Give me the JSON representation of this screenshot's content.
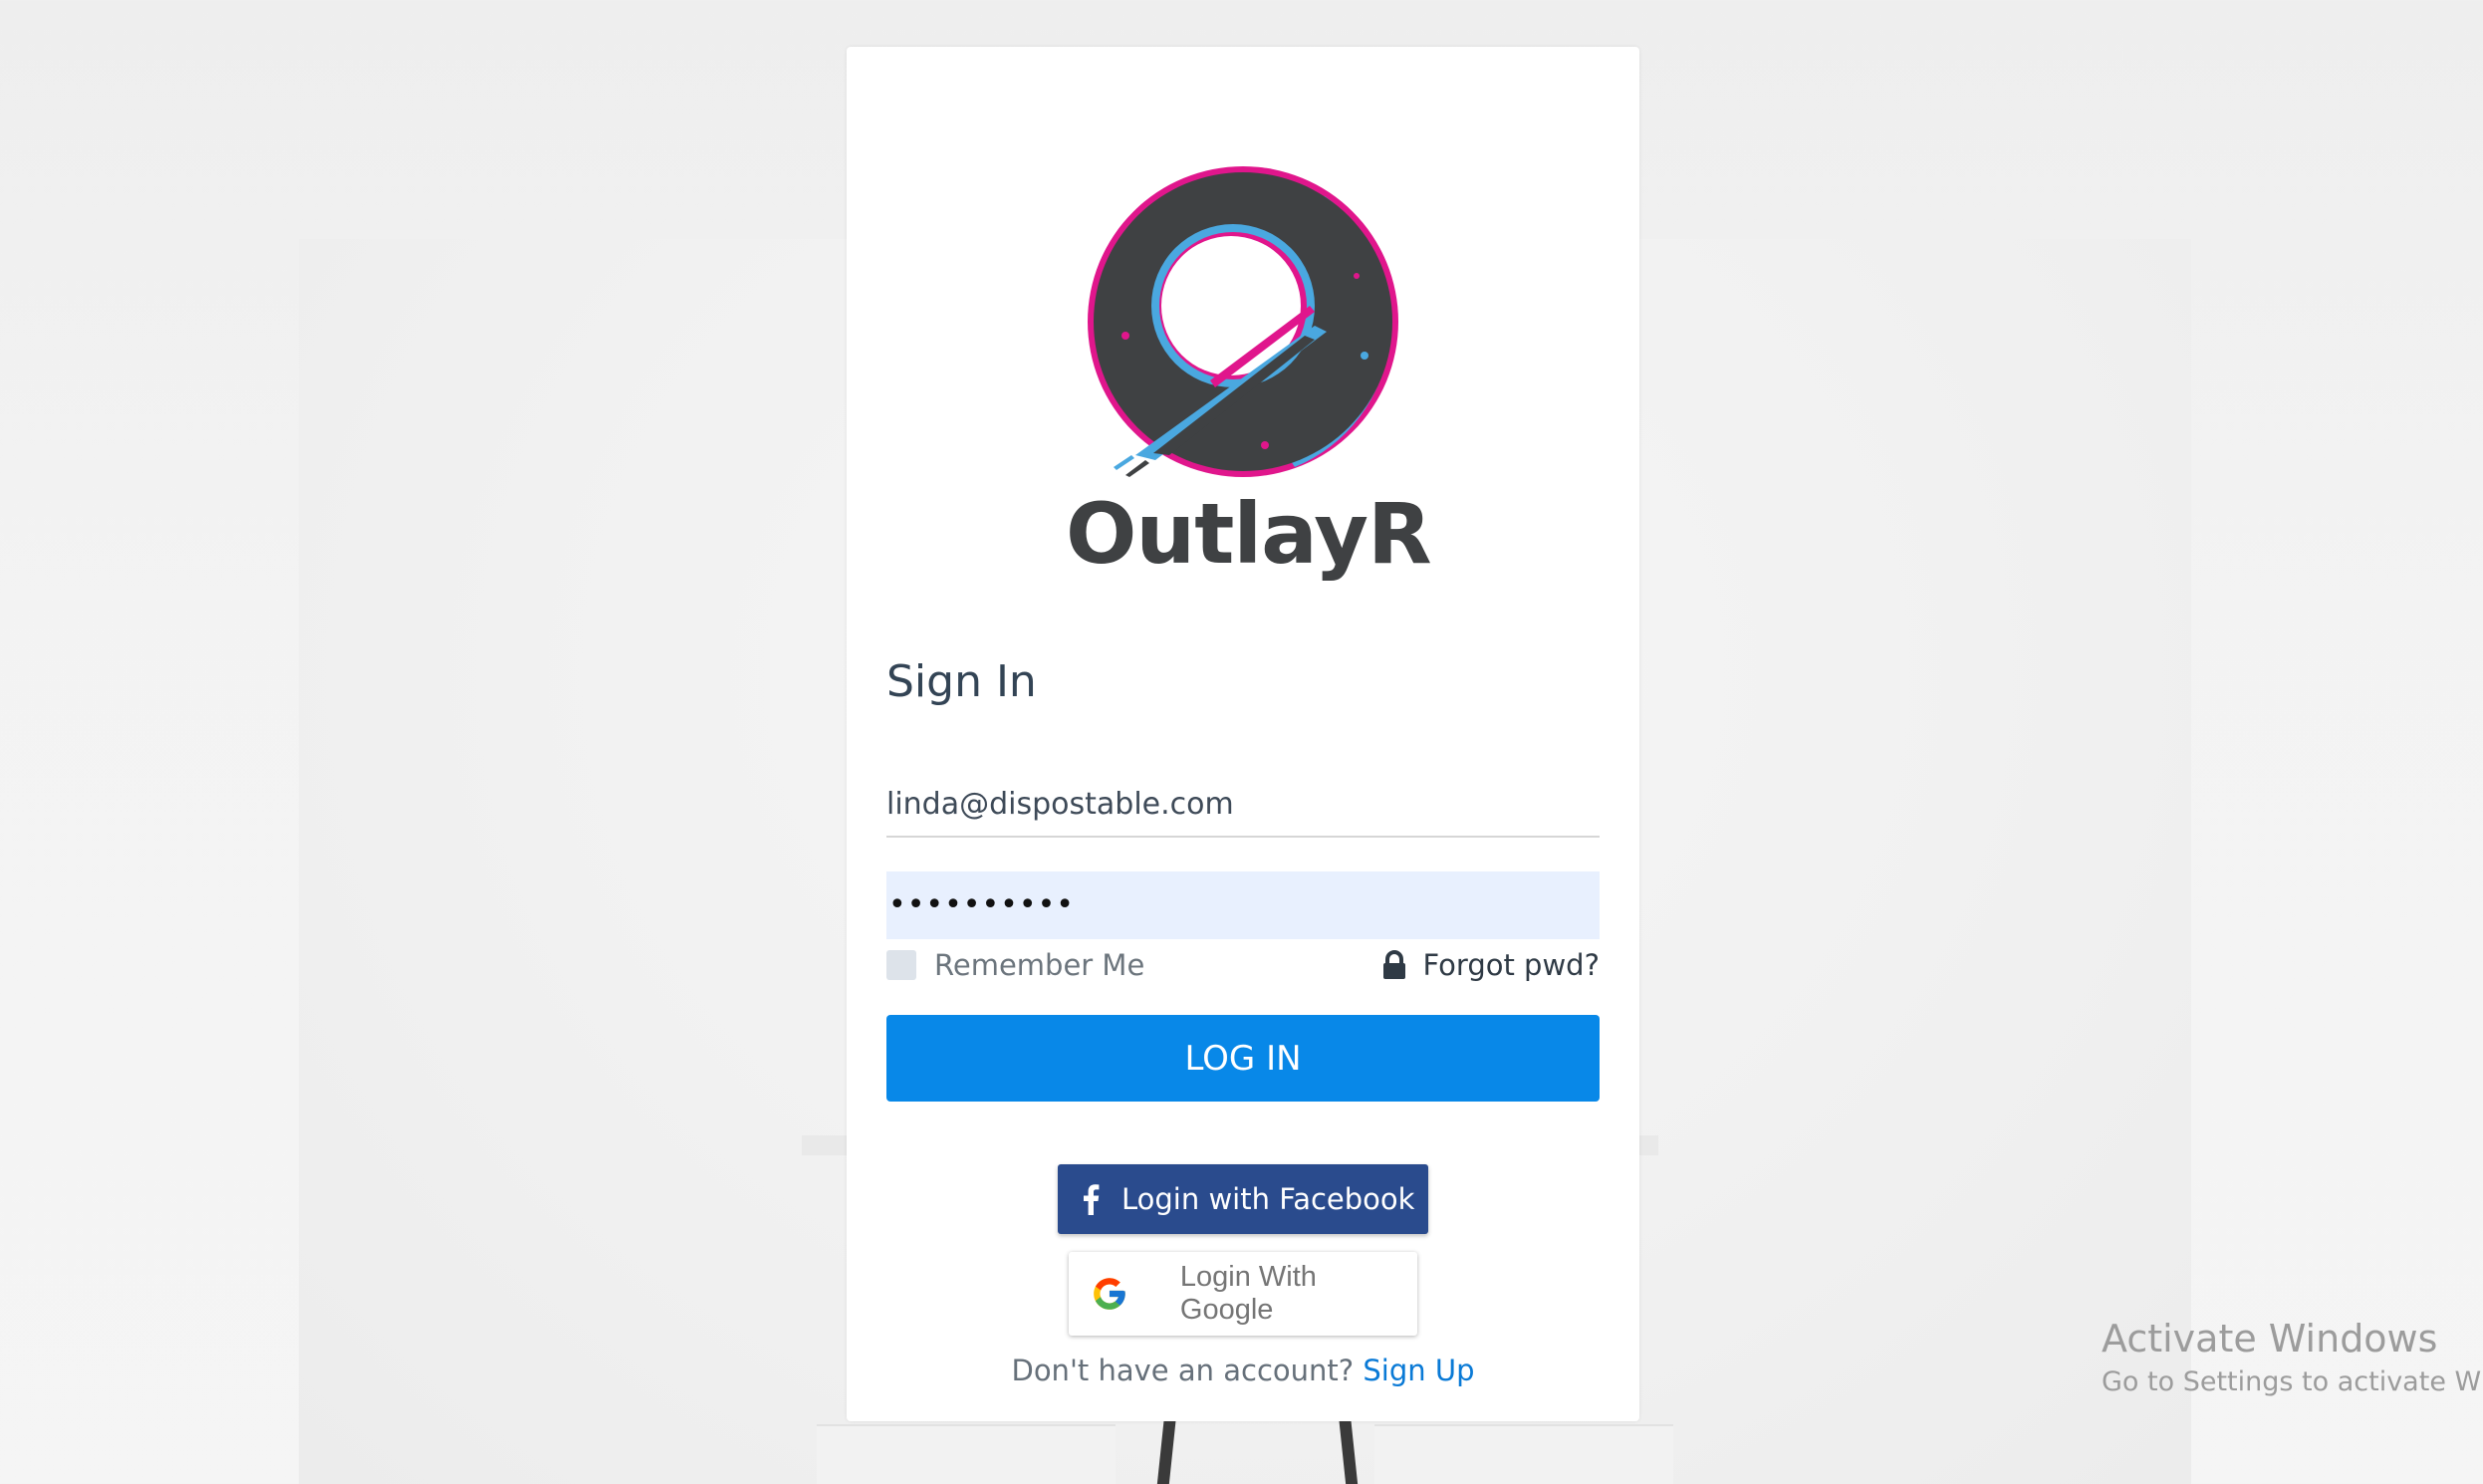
{
  "app": {
    "brand_name": "OutlayR"
  },
  "form": {
    "title": "Sign In",
    "email_value": "linda@dispostable.com",
    "password_value": "••••••••••",
    "remember_label": "Remember Me",
    "forgot_label": "Forgot pwd?",
    "login_label": "LOG IN"
  },
  "social": {
    "facebook_label": "Login with Facebook",
    "google_label": "Login With Google"
  },
  "signup": {
    "prompt": "Don't have an account?",
    "link_label": "Sign Up"
  },
  "os_watermark": {
    "title": "Activate Windows",
    "subtitle": "Go to Settings to activate Win"
  },
  "colors": {
    "primary": "#0888e8",
    "facebook": "#2a4b8d",
    "logo_dark": "#3f4143",
    "logo_pink": "#e0168c",
    "logo_blue": "#4aa8e0"
  },
  "icons": {
    "lock": "lock-icon",
    "facebook": "facebook-icon",
    "google": "google-icon"
  }
}
